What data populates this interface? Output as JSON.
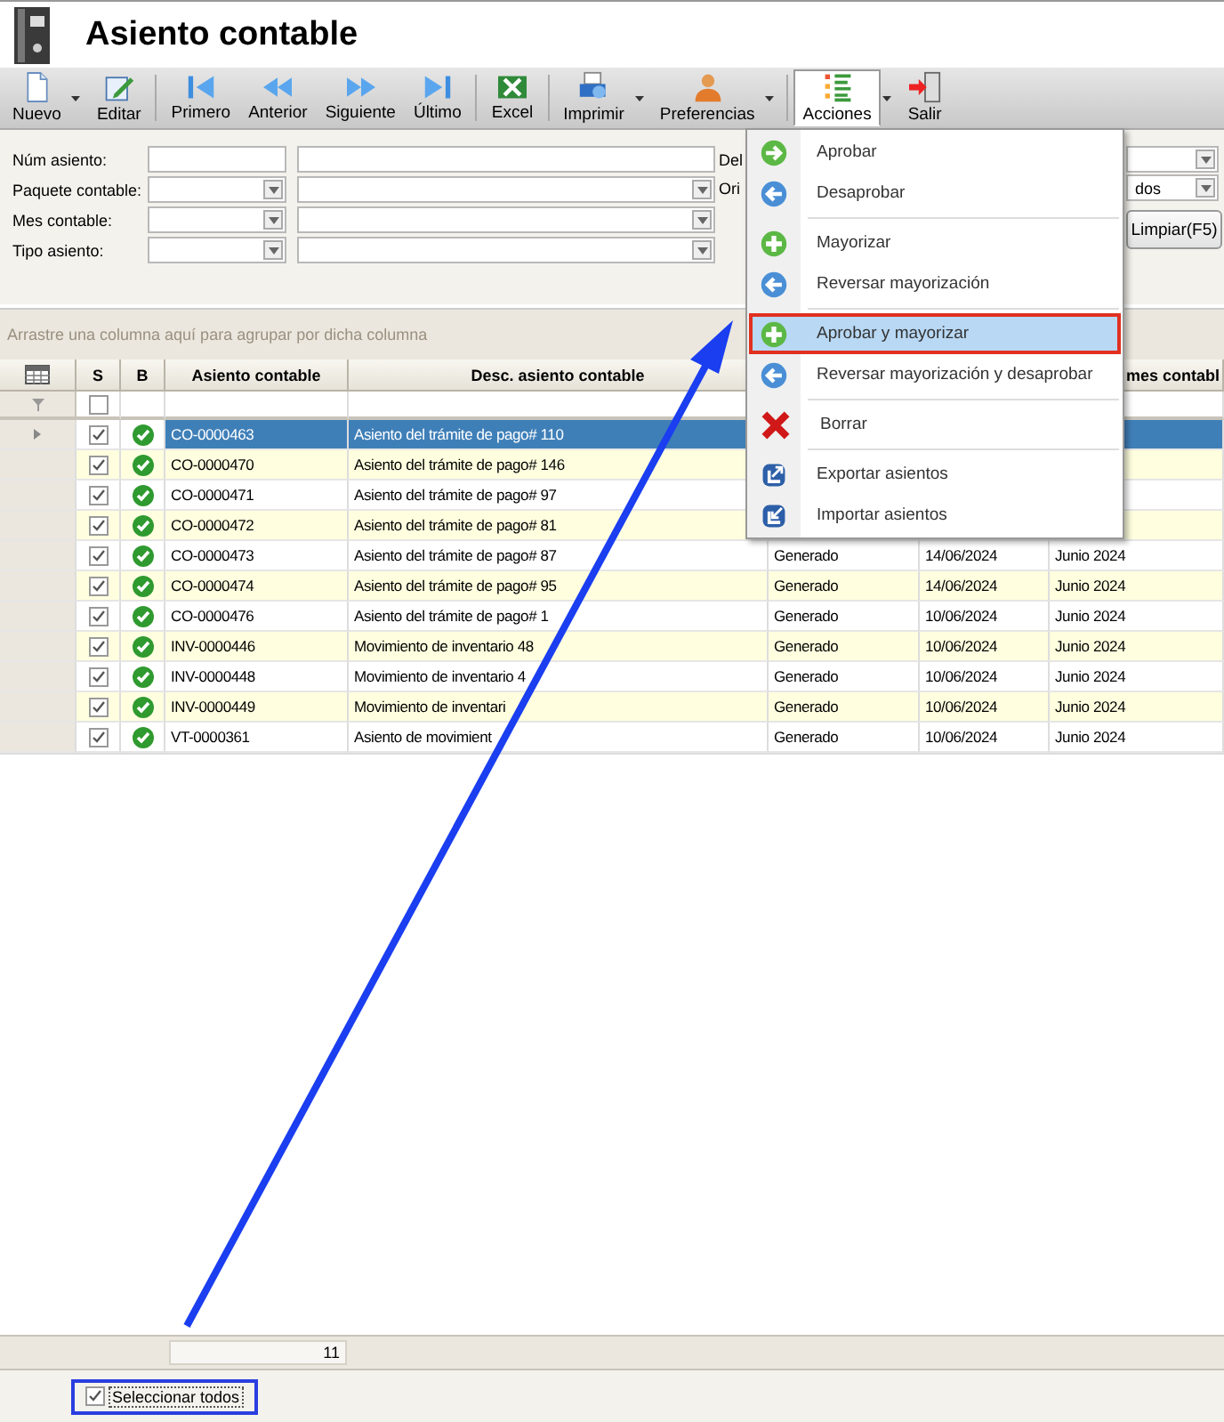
{
  "window": {
    "title": "Asiento contable"
  },
  "toolbar": [
    {
      "label": "Nuevo",
      "dropdown": true,
      "expanded": false
    },
    {
      "label": "Editar",
      "dropdown": false,
      "expanded": false
    },
    {
      "label": "Primero",
      "dropdown": false,
      "expanded": false
    },
    {
      "label": "Anterior",
      "dropdown": false,
      "expanded": false
    },
    {
      "label": "Siguiente",
      "dropdown": false,
      "expanded": false
    },
    {
      "label": "Último",
      "dropdown": false,
      "expanded": false
    },
    {
      "label": "Excel",
      "dropdown": false,
      "expanded": false
    },
    {
      "label": "Imprimir",
      "dropdown": true,
      "expanded": false
    },
    {
      "label": "Preferencias",
      "dropdown": true,
      "expanded": false
    },
    {
      "label": "Acciones",
      "dropdown": true,
      "expanded": true
    },
    {
      "label": "Salir",
      "dropdown": false,
      "expanded": false
    }
  ],
  "filters": [
    {
      "label": "Núm asiento:",
      "kind": "text"
    },
    {
      "label": "Paquete contable:",
      "kind": "select"
    },
    {
      "label": "Mes contable:",
      "kind": "select"
    },
    {
      "label": "Tipo asiento:",
      "kind": "select"
    }
  ],
  "filters_right": [
    {
      "label": "Del"
    },
    {
      "label": "Ori",
      "value": "dos"
    }
  ],
  "clear_button": "Limpiar(F5)",
  "group_panel": {
    "hint": "Arrastre una columna aquí para agrupar por dicha columna"
  },
  "grid": {
    "columns": {
      "s": "S",
      "b": "B",
      "asiento": "Asiento contable",
      "desc": "Desc. asiento contable",
      "column_8": "mes contabl"
    },
    "filter_row": {
      "checked": false
    },
    "rows": [
      {
        "selected": true,
        "checked": true,
        "approved": true,
        "asiento": "CO-0000463",
        "desc": "Asiento del trámite de pago# 110"
      },
      {
        "selected": false,
        "checked": true,
        "approved": true,
        "asiento": "CO-0000470",
        "desc": "Asiento del trámite de pago# 146"
      },
      {
        "selected": false,
        "checked": true,
        "approved": true,
        "asiento": "CO-0000471",
        "desc": "Asiento del trámite de pago# 97"
      },
      {
        "selected": false,
        "checked": true,
        "approved": true,
        "asiento": "CO-0000472",
        "desc": "Asiento del trámite de pago# 81"
      },
      {
        "selected": false,
        "checked": true,
        "approved": true,
        "asiento": "CO-0000473",
        "desc": "Asiento del trámite de pago# 87",
        "column_6": "Generado",
        "column_7": "14/06/2024",
        "column_8": "Junio 2024"
      },
      {
        "selected": false,
        "checked": true,
        "approved": true,
        "asiento": "CO-0000474",
        "desc": "Asiento del trámite de pago# 95",
        "column_6": "Generado",
        "column_7": "14/06/2024",
        "column_8": "Junio 2024"
      },
      {
        "selected": false,
        "checked": true,
        "approved": true,
        "asiento": "CO-0000476",
        "desc": "Asiento del trámite de pago# 1",
        "column_6": "Generado",
        "column_7": "10/06/2024",
        "column_8": "Junio 2024"
      },
      {
        "selected": false,
        "checked": true,
        "approved": true,
        "asiento": "INV-0000446",
        "desc": "Movimiento de inventario 48",
        "column_6": "Generado",
        "column_7": "10/06/2024",
        "column_8": "Junio 2024"
      },
      {
        "selected": false,
        "checked": true,
        "approved": true,
        "asiento": "INV-0000448",
        "desc": "Movimiento de inventario 4",
        "column_6": "Generado",
        "column_7": "10/06/2024",
        "column_8": "Junio 2024"
      },
      {
        "selected": false,
        "checked": true,
        "approved": true,
        "asiento": "INV-0000449",
        "desc": "Movimiento de inventari",
        "column_6": "Generado",
        "column_7": "10/06/2024",
        "column_8": "Junio 2024"
      },
      {
        "selected": false,
        "checked": true,
        "approved": true,
        "asiento": "VT-0000361",
        "desc": "Asiento de movimient",
        "column_6": "Generado",
        "column_7": "10/06/2024",
        "column_8": "Junio 2024"
      }
    ],
    "summary": {
      "count": "11"
    }
  },
  "select_all": {
    "label": "Seleccionar todos",
    "checked": true
  },
  "menu": {
    "items": [
      {
        "label": "Aprobar",
        "selected": false,
        "separator_before": false
      },
      {
        "label": "Desaprobar",
        "selected": false,
        "separator_before": false
      },
      {
        "label": "Mayorizar",
        "selected": false,
        "separator_before": true
      },
      {
        "label": "Reversar mayorización",
        "selected": false,
        "separator_before": false
      },
      {
        "label": "Aprobar y mayorizar",
        "selected": true,
        "separator_before": true
      },
      {
        "label": "Reversar mayorización y desaprobar",
        "selected": false,
        "separator_before": false
      },
      {
        "label": "Borrar",
        "selected": false,
        "separator_before": true
      },
      {
        "label": "Exportar asientos",
        "selected": false,
        "separator_before": true
      },
      {
        "label": "Importar asientos",
        "selected": false,
        "separator_before": false
      }
    ]
  }
}
